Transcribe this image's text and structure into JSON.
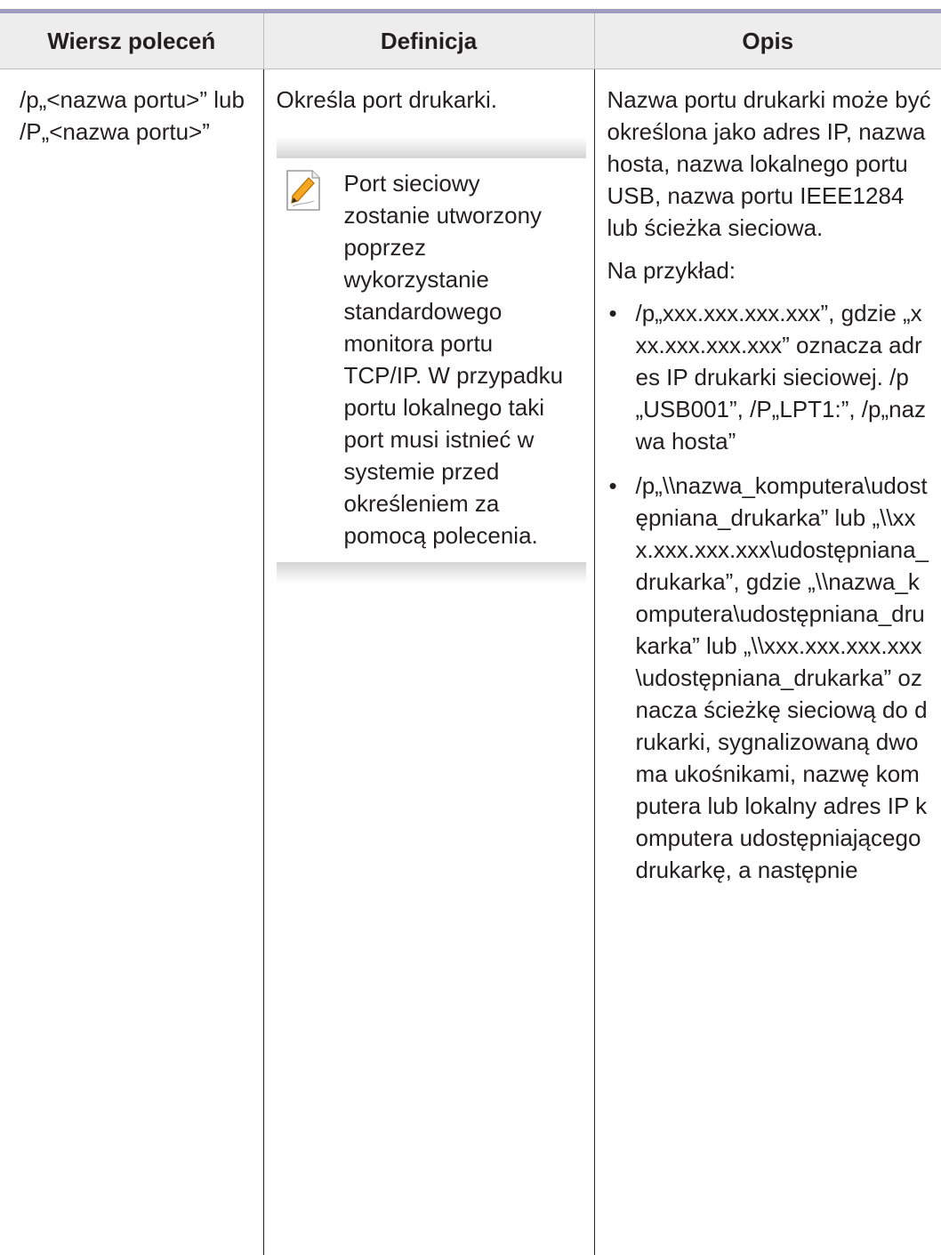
{
  "table": {
    "headers": {
      "command": "Wiersz poleceń",
      "definition": "Definicja",
      "description": "Opis"
    },
    "row": {
      "command": "/p„<nazwa portu>” lub /P„<nazwa portu>”",
      "definition": "Określa port drukarki.",
      "note": "Port sieciowy zostanie utworzony poprzez wykorzystanie standardowego monitora portu TCP/IP. W przypadku portu lokalnego taki port musi istnieć w systemie przed określeniem za pomocą polecenia.",
      "description_intro": "Nazwa portu drukarki może być określona jako adres IP, nazwa hosta, nazwa lokalnego portu USB, nazwa portu IEEE1284 lub ścieżka sieciowa.",
      "example_label": "Na przykład:",
      "bullet_symbol": "•",
      "examples": [
        "/p„xxx.xxx.xxx.xxx”, gdzie „xxx.xxx.xxx.xxx” oznacza adres IP drukarki sieciowej. /p„USB001”, /P„LPT1:”, /p„nazwa hosta”",
        "/p„\\\\nazwa_komputera\\udostępniana_drukarka” lub „\\\\xxx.xxx.xxx.xxx\\udostępniana_drukarka”, gdzie „\\\\nazwa_komputera\\udostępniana_drukarka” lub „\\\\xxx.xxx.xxx.xxx\\udostępniana_drukarka” oznacza ścieżkę sieciową do drukarki, sygnalizowaną dwoma ukośnikami, nazwę komputera lub lokalny adres IP komputera udostępniającego drukarkę, a następnie"
      ]
    }
  },
  "note_icon": "note-pencil-icon",
  "colors": {
    "top_rule": "#9f9cc0",
    "header_bg": "#ededed",
    "text": "#231f20",
    "note_icon_accent": "#f5a623"
  }
}
